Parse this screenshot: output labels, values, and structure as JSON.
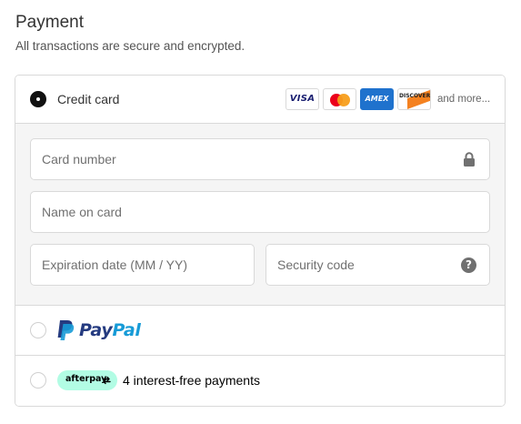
{
  "header": {
    "title": "Payment",
    "subtitle": "All transactions are secure and encrypted."
  },
  "credit_card": {
    "label": "Credit card",
    "selected": true,
    "card_brands": [
      "visa-logo",
      "mastercard-logo",
      "amex-logo",
      "discover-logo"
    ],
    "card_text": {
      "visa": "VISA",
      "amex": "AMEX",
      "discover": "DISCOVER"
    },
    "and_more": "and more...",
    "fields": {
      "card_number_placeholder": "Card number",
      "name_placeholder": "Name on card",
      "expiration_placeholder": "Expiration date (MM / YY)",
      "security_placeholder": "Security code"
    },
    "card_number_icon": "lock-icon",
    "security_icon": "help-icon",
    "help_glyph": "?"
  },
  "paypal": {
    "selected": false,
    "logo_text_pay": "Pay",
    "logo_text_pal": "Pal",
    "colors": {
      "dark": "#253b80",
      "light": "#179bd7"
    }
  },
  "afterpay": {
    "selected": false,
    "badge_text": "afterpay",
    "label": "4 interest-free payments",
    "badge_color": "#b2fce4"
  }
}
